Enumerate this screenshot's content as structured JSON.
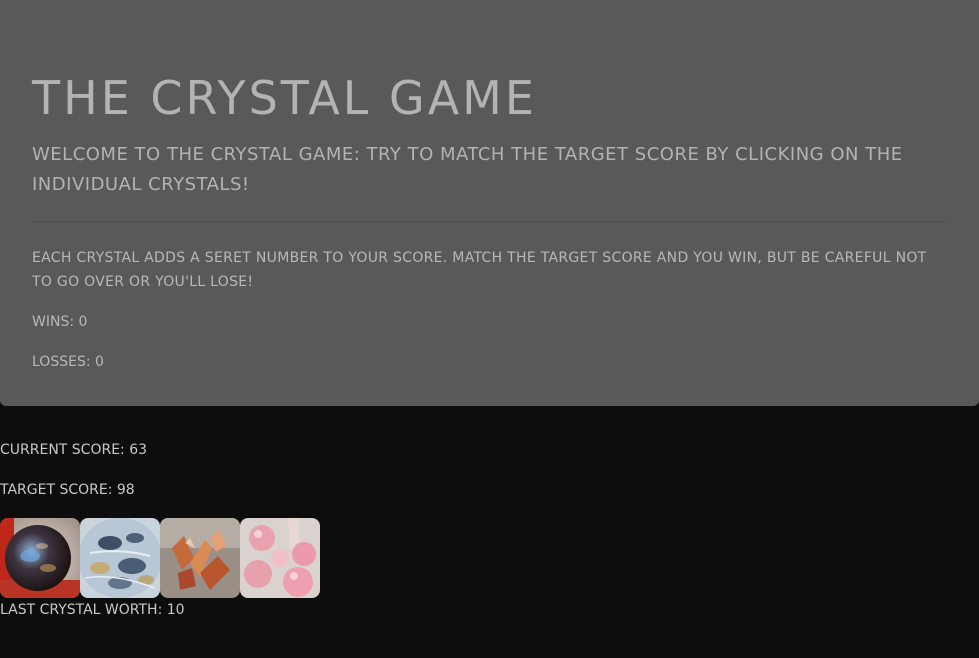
{
  "header": {
    "title": "The Crystal Game",
    "welcome": "Welcome to the Crystal Game: Try to match the target score by clicking on the individual crystals!",
    "rules": "Each crystal adds a seret number to your score. Match the target score and you win, but be careful not to go over or you'll lose!"
  },
  "stats": {
    "wins": "Wins: 0",
    "losses": "Losses: 0",
    "current_score": "Current Score: 63",
    "target_score": "Target Score: 98",
    "last_crystal": "Last crystal worth: 10"
  },
  "crystals": [
    {
      "icon": "opal-crystal-icon"
    },
    {
      "icon": "dendritic-agate-crystal-icon"
    },
    {
      "icon": "orange-quartz-crystal-icon"
    },
    {
      "icon": "rose-quartz-crystal-icon"
    }
  ],
  "colors": {
    "page_background": "#0d0d0d",
    "jumbotron_background": "#595959",
    "text": "#b3b3b3"
  }
}
